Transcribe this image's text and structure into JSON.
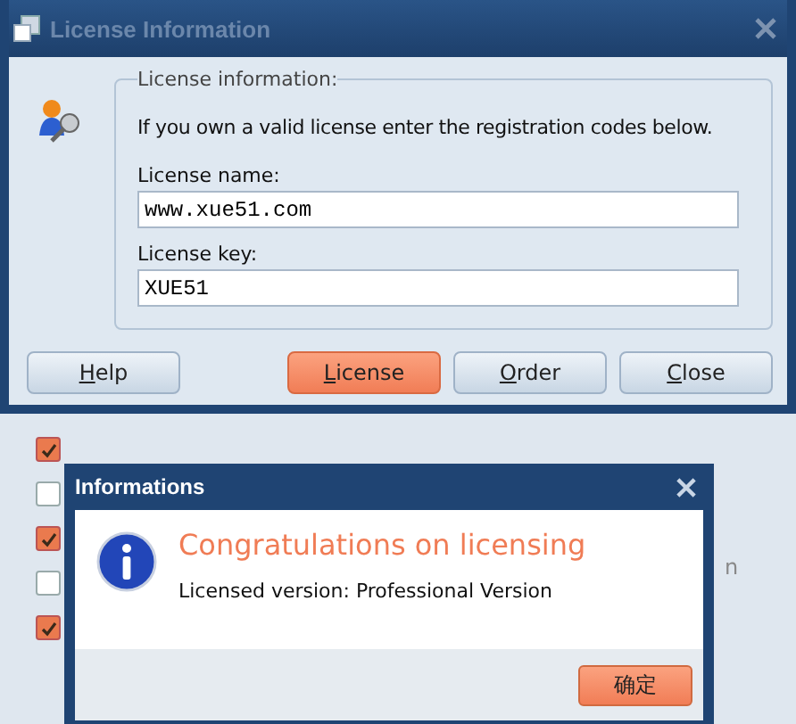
{
  "window": {
    "title": "License Information",
    "active": false
  },
  "group": {
    "legend": "License information:",
    "intro": "If you own a valid license enter the registration codes below.",
    "fields": [
      {
        "label": "License name:",
        "value": "www.xue51.com"
      },
      {
        "label": "License key:",
        "value": "XUE51"
      }
    ]
  },
  "buttons": [
    {
      "label": "Help",
      "primary": false
    },
    {
      "label": "License",
      "primary": true
    },
    {
      "label": "Order",
      "primary": false
    },
    {
      "label": "Close",
      "primary": false
    }
  ],
  "background": {
    "checkboxes": [
      {
        "checked": true
      },
      {
        "checked": false
      },
      {
        "checked": true
      },
      {
        "checked": false
      },
      {
        "checked": true
      }
    ],
    "text_fragment": "n"
  },
  "dialog": {
    "title": "Informations",
    "heading": "Congratulations on licensing",
    "message": "Licensed version: Professional Version",
    "button": "确定"
  }
}
